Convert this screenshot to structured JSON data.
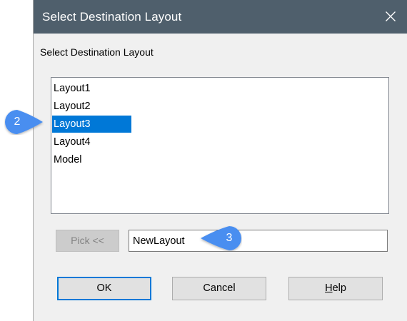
{
  "window": {
    "title": "Select Destination Layout",
    "close_icon": "close-icon"
  },
  "caption": "Select Destination Layout",
  "layouts": {
    "items": [
      "Layout1",
      "Layout2",
      "Layout3",
      "Layout4",
      "Model"
    ],
    "selected": "Layout3"
  },
  "pick_button": {
    "label": "Pick <<",
    "enabled": false
  },
  "name_input": {
    "value": "NewLayout"
  },
  "buttons": {
    "ok": "OK",
    "cancel": "Cancel",
    "help_first": "H",
    "help_rest": "elp"
  },
  "callouts": {
    "list_callout": "2",
    "input_callout": "3",
    "color": "#4a8ef0"
  },
  "colors": {
    "titlebar": "#4f5f6c",
    "selection": "#0078d7",
    "dialog_bg": "#f0f0f0"
  }
}
